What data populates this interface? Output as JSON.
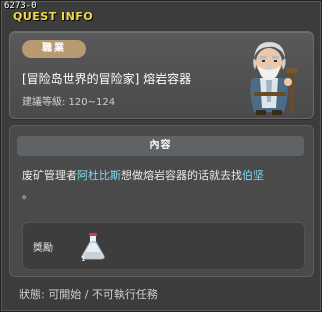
{
  "window": {
    "id_label": "6273-0",
    "title": "QUEST INFO"
  },
  "header": {
    "job_badge": "職業",
    "quest_name": "[冒险岛世界的冒险家] 熔岩容器",
    "level_text": "建議等級: 120~124"
  },
  "content": {
    "heading": "內容",
    "text_before": "废矿管理者",
    "npc_name": "阿杜比斯",
    "text_middle": "想做熔岩容器的话就去找",
    "target_name": "伯坚",
    "text_after": "。"
  },
  "reward": {
    "label": "獎勵",
    "item_icon": "flask-icon"
  },
  "status": {
    "text": "狀態: 可開始 / 不可執行任務"
  },
  "colors": {
    "title": "#f2d84a",
    "highlight": "#7fd9f0",
    "badge": "#b79a72"
  }
}
